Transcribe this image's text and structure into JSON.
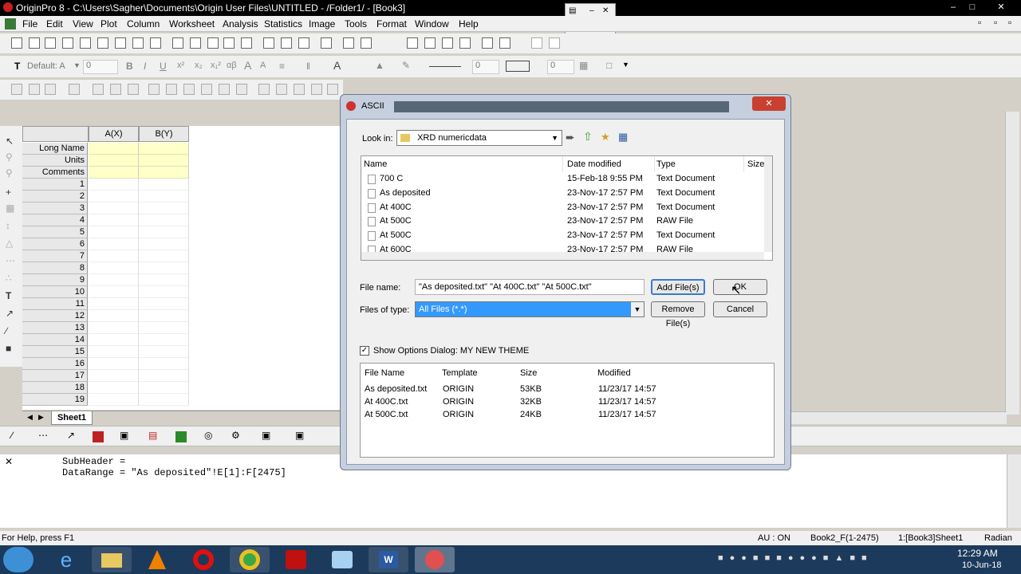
{
  "app": {
    "title": "OriginPro 8 - C:\\Users\\Sagher\\Documents\\Origin User Files\\UNTITLED - /Folder1/ - [Book3]"
  },
  "menu": [
    "File",
    "Edit",
    "View",
    "Plot",
    "Column",
    "Worksheet",
    "Analysis",
    "Statistics",
    "Image",
    "Tools",
    "Format",
    "Window",
    "Help"
  ],
  "format_toolbar": {
    "font": "Default: A",
    "size": "0",
    "size2": "0",
    "size3": "0"
  },
  "worksheet": {
    "col_a": "A(X)",
    "col_b": "B(Y)",
    "row_labels": [
      "Long Name",
      "Units",
      "Comments"
    ],
    "rows": [
      "1",
      "2",
      "3",
      "4",
      "5",
      "6",
      "7",
      "8",
      "9",
      "10",
      "11",
      "12",
      "13",
      "14",
      "15",
      "16",
      "17",
      "18",
      "19"
    ],
    "sheet_tab": "Sheet1"
  },
  "script_window": {
    "line1": "SubHeader =",
    "line2": "DataRange = \"As deposited\"!E[1]:F[2475]"
  },
  "status": {
    "help": "For Help, press F1",
    "au": "AU : ON",
    "book": "Book2_F(1-2475)",
    "sheet": "1:[Book3]Sheet1",
    "unit": "Radian"
  },
  "clock": {
    "time": "12:29 AM",
    "date": "10-Jun-18"
  },
  "dialog": {
    "title": "ASCII",
    "look_in_label": "Look in:",
    "look_in_value": "XRD numericdata",
    "columns": [
      "Name",
      "Date modified",
      "Type",
      "Size"
    ],
    "files": [
      {
        "name": "700 C",
        "date": "15-Feb-18 9:55 PM",
        "type": "Text Document"
      },
      {
        "name": "As deposited",
        "date": "23-Nov-17 2:57 PM",
        "type": "Text Document"
      },
      {
        "name": "At 400C",
        "date": "23-Nov-17 2:57 PM",
        "type": "Text Document"
      },
      {
        "name": "At 500C",
        "date": "23-Nov-17 2:57 PM",
        "type": "RAW File"
      },
      {
        "name": "At 500C",
        "date": "23-Nov-17 2:57 PM",
        "type": "Text Document"
      },
      {
        "name": "At 600C",
        "date": "23-Nov-17 2:57 PM",
        "type": "RAW File"
      }
    ],
    "file_name_label": "File name:",
    "file_name_value": "\"As deposited.txt\" \"At 400C.txt\" \"At 500C.txt\"",
    "files_of_type_label": "Files of type:",
    "files_of_type_value": "All Files (*.*)",
    "add_button": "Add File(s)",
    "ok_button": "OK",
    "remove_button": "Remove File(s)",
    "cancel_button": "Cancel",
    "show_options": "Show Options Dialog: MY NEW THEME",
    "show_options_checked": true,
    "sel_columns": [
      "File Name",
      "Template",
      "Size",
      "Modified"
    ],
    "selected": [
      {
        "name": "As deposited.txt",
        "template": "ORIGIN",
        "size": "53KB",
        "modified": "11/23/17 14:57"
      },
      {
        "name": "At 400C.txt",
        "template": "ORIGIN",
        "size": "32KB",
        "modified": "11/23/17 14:57"
      },
      {
        "name": "At 500C.txt",
        "template": "ORIGIN",
        "size": "24KB",
        "modified": "11/23/17 14:57"
      }
    ]
  }
}
